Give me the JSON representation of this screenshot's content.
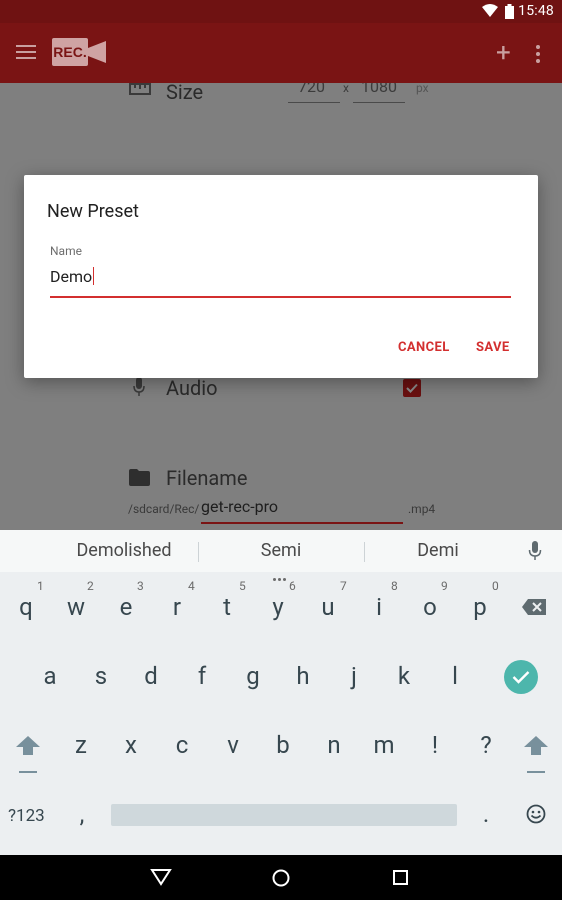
{
  "status_bar": {
    "time": "15:48",
    "icons": [
      "wifi-icon",
      "battery-icon"
    ]
  },
  "app_bar": {
    "logo_text": "REC.",
    "actions": [
      "add-icon",
      "more-vert-icon"
    ]
  },
  "background_form": {
    "size": {
      "label": "Size",
      "width_value": "720",
      "separator": "x",
      "height_value": "1080",
      "unit": "px"
    },
    "audio": {
      "label": "Audio",
      "checked": true
    },
    "filename": {
      "label": "Filename",
      "path_prefix": "/sdcard/Rec/",
      "value": "get-rec-pro",
      "extension": ".mp4"
    }
  },
  "dialog": {
    "title": "New Preset",
    "name_label": "Name",
    "name_value": "Demo",
    "cancel_label": "CANCEL",
    "save_label": "SAVE"
  },
  "keyboard": {
    "suggestions": [
      "Demolished",
      "Semi",
      "Demi"
    ],
    "row1": [
      {
        "key": "q",
        "hint": "1"
      },
      {
        "key": "w",
        "hint": "2"
      },
      {
        "key": "e",
        "hint": "3"
      },
      {
        "key": "r",
        "hint": "4"
      },
      {
        "key": "t",
        "hint": "5"
      },
      {
        "key": "y",
        "hint": "6"
      },
      {
        "key": "u",
        "hint": "7"
      },
      {
        "key": "i",
        "hint": "8"
      },
      {
        "key": "o",
        "hint": "9"
      },
      {
        "key": "p",
        "hint": "0"
      }
    ],
    "row2": [
      "a",
      "s",
      "d",
      "f",
      "g",
      "h",
      "j",
      "k",
      "l"
    ],
    "row3": [
      "z",
      "x",
      "c",
      "v",
      "b",
      "n",
      "m",
      "!",
      "?"
    ],
    "row4": {
      "symbols_label": "?123",
      "comma": ",",
      "period": "."
    }
  },
  "colors": {
    "accent": "#d32f2f",
    "app_bar": "#7a1414",
    "status_bar": "#6f1212",
    "enter_key": "#4db6ac"
  }
}
